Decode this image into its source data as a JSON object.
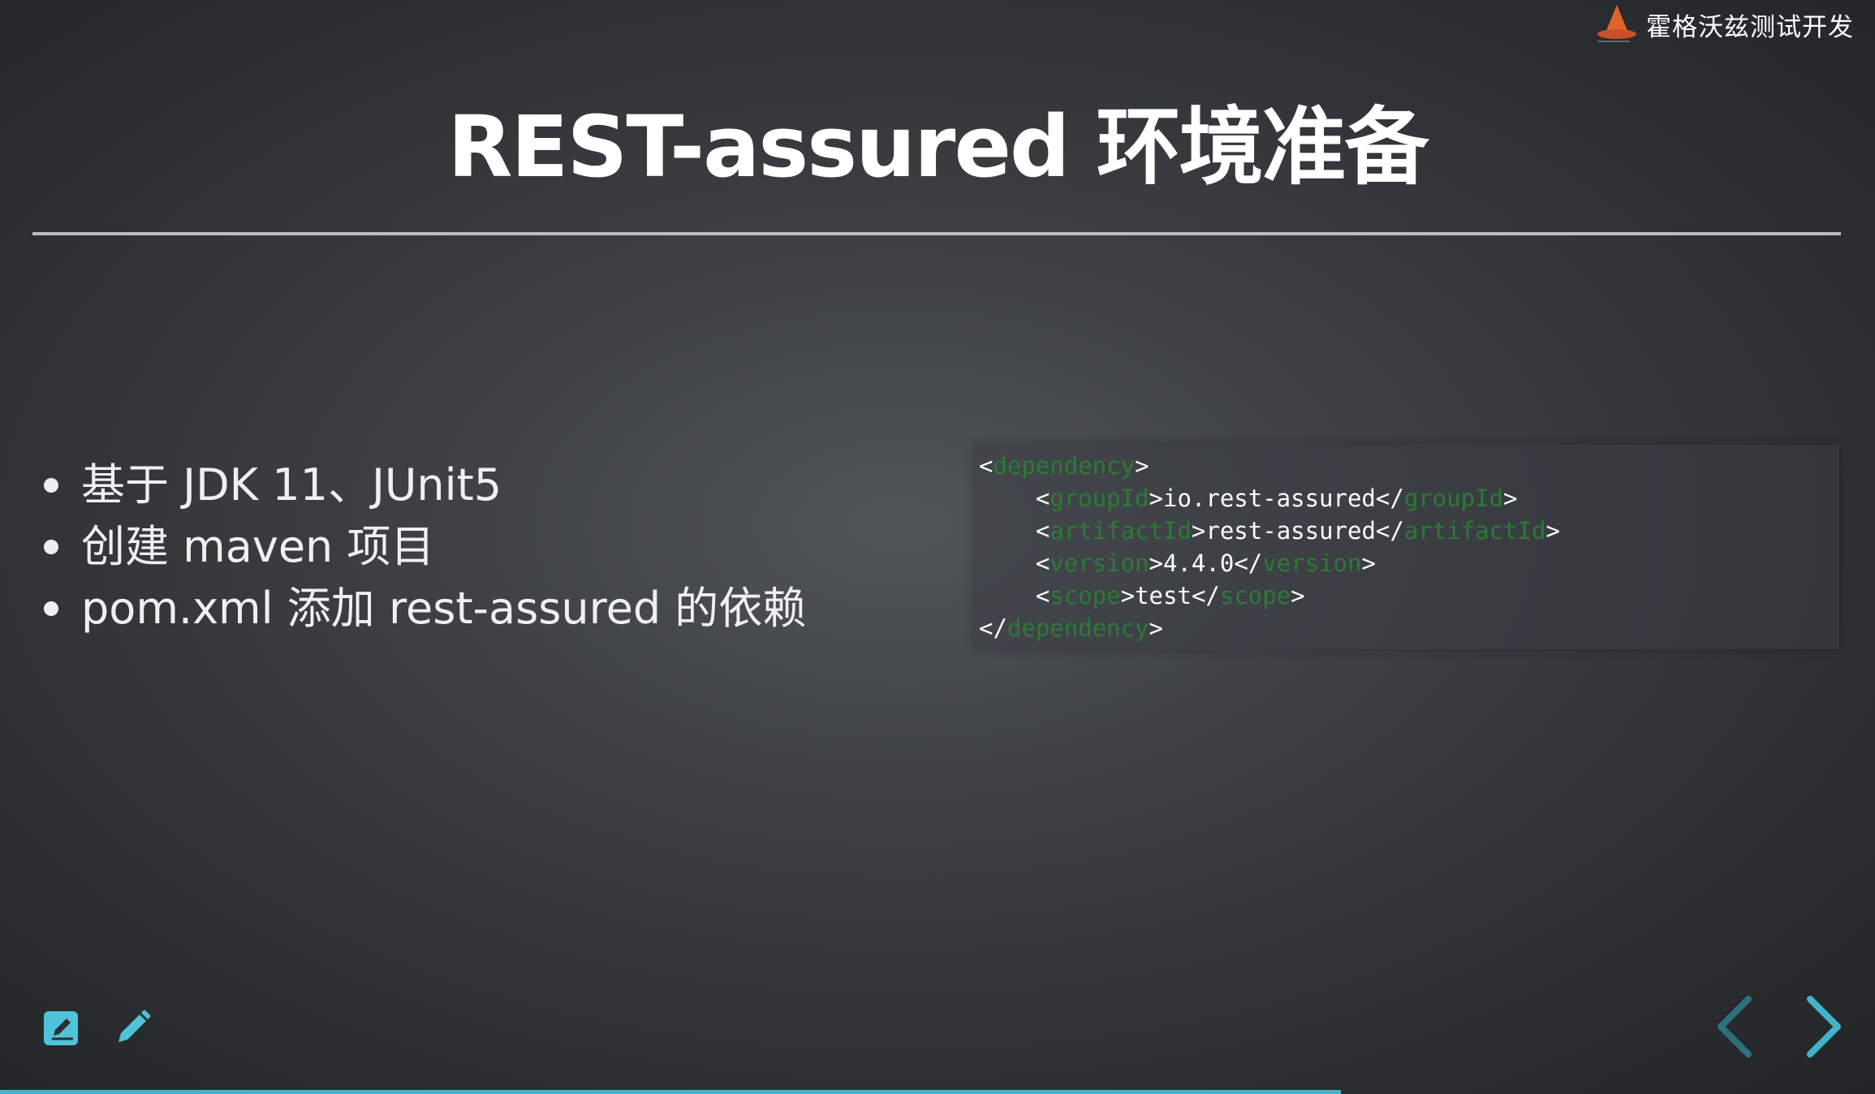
{
  "brand": {
    "name": "霍格沃兹测试开发",
    "logo_icon": "wizard-hat-icon"
  },
  "slide": {
    "title": "REST-assured 环境准备",
    "bullets": [
      "基于 JDK 11、JUnit5",
      "创建 maven 项目",
      "pom.xml 添加 rest-assured 的依赖"
    ]
  },
  "code": {
    "lines": [
      {
        "indent": "",
        "open": "<",
        "tag": "dependency",
        "mid": ">",
        "value": "",
        "close_open": "",
        "close_tag": "",
        "end": ""
      },
      {
        "indent": "    ",
        "open": "<",
        "tag": "groupId",
        "mid": ">",
        "value": "io.rest-assured",
        "close_open": "</",
        "close_tag": "groupId",
        "end": ">"
      },
      {
        "indent": "    ",
        "open": "<",
        "tag": "artifactId",
        "mid": ">",
        "value": "rest-assured",
        "close_open": "</",
        "close_tag": "artifactId",
        "end": ">"
      },
      {
        "indent": "    ",
        "open": "<",
        "tag": "version",
        "mid": ">",
        "value": "4.4.0",
        "close_open": "</",
        "close_tag": "version",
        "end": ">"
      },
      {
        "indent": "    ",
        "open": "<",
        "tag": "scope",
        "mid": ">",
        "value": "test",
        "close_open": "</",
        "close_tag": "scope",
        "end": ">"
      },
      {
        "indent": "",
        "open": "</",
        "tag": "dependency",
        "mid": ">",
        "value": "",
        "close_open": "",
        "close_tag": "",
        "end": ""
      }
    ]
  },
  "controls": {
    "edit_icon": "edit-square-icon",
    "pencil_icon": "pencil-icon",
    "prev_icon": "chevron-left-icon",
    "next_icon": "chevron-right-icon"
  },
  "progress": {
    "fraction": 0.715
  },
  "colors": {
    "accent": "#42b6c9",
    "code_tag": "#2c7a36",
    "title": "#ffffff"
  }
}
